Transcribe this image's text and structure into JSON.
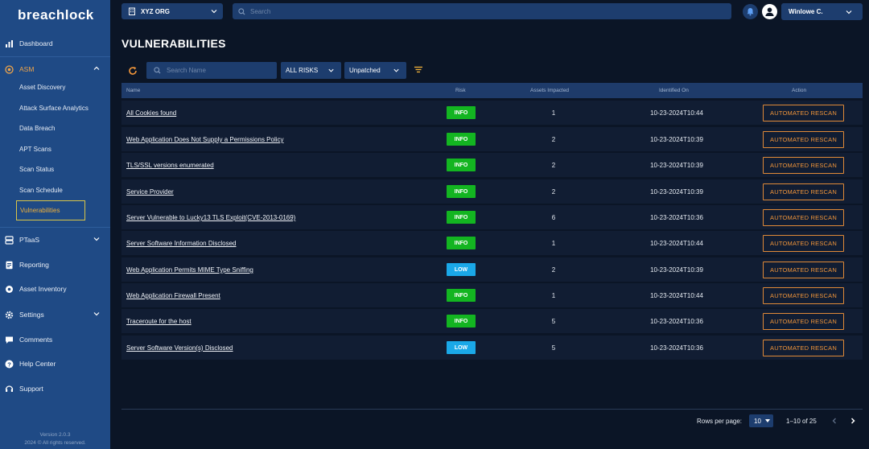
{
  "app": {
    "logo": "breachlock",
    "org": "XYZ ORG",
    "search_placeholder": "Search",
    "user": "Winlowe C."
  },
  "sidebar": {
    "dashboard": "Dashboard",
    "asm": "ASM",
    "asm_items": [
      "Asset Discovery",
      "Attack Surface Analytics",
      "Data Breach",
      "APT Scans",
      "Scan Status",
      "Scan Schedule",
      "Vulnerabilities"
    ],
    "ptaas": "PTaaS",
    "reporting": "Reporting",
    "asset_inventory": "Asset Inventory",
    "settings": "Settings",
    "comments": "Comments",
    "help_center": "Help Center",
    "support": "Support",
    "version": "Version 2.0.3",
    "copyright": "2024 © All rights reserved."
  },
  "page": {
    "title": "VULNERABILITIES"
  },
  "filters": {
    "search_placeholder": "Search Name",
    "risk": "ALL RISKS",
    "status": "Unpatched"
  },
  "table": {
    "headers": {
      "name": "Name",
      "risk": "Risk",
      "assets": "Assets Impacted",
      "identified": "Identified On",
      "action": "Action"
    },
    "action_label": "AUTOMATED RESCAN",
    "rows": [
      {
        "name": "All Cookies found",
        "risk": "INFO",
        "assets": "1",
        "identified": "10-23-2024T10:44"
      },
      {
        "name": "Web Application Does Not Supply a Permissions Policy",
        "risk": "INFO",
        "assets": "2",
        "identified": "10-23-2024T10:39"
      },
      {
        "name": "TLS/SSL versions enumerated",
        "risk": "INFO",
        "assets": "2",
        "identified": "10-23-2024T10:39"
      },
      {
        "name": "Service Provider",
        "risk": "INFO",
        "assets": "2",
        "identified": "10-23-2024T10:39"
      },
      {
        "name": "Server Vulnerable to Lucky13 TLS Exploit(CVE-2013-0169)",
        "risk": "INFO",
        "assets": "6",
        "identified": "10-23-2024T10:36"
      },
      {
        "name": "Server Software Information Disclosed",
        "risk": "INFO",
        "assets": "1",
        "identified": "10-23-2024T10:44"
      },
      {
        "name": "Web Application Permits MIME Type Sniffing",
        "risk": "LOW",
        "assets": "2",
        "identified": "10-23-2024T10:39"
      },
      {
        "name": "Web Application Firewall Present",
        "risk": "INFO",
        "assets": "1",
        "identified": "10-23-2024T10:44"
      },
      {
        "name": "Traceroute for the host",
        "risk": "INFO",
        "assets": "5",
        "identified": "10-23-2024T10:36"
      },
      {
        "name": "Server Software Version(s) Disclosed",
        "risk": "LOW",
        "assets": "5",
        "identified": "10-23-2024T10:36"
      }
    ]
  },
  "pagination": {
    "rows_per_page_label": "Rows per page:",
    "rows_per_page": "10",
    "range": "1–10 of 25"
  },
  "colors": {
    "info": "#13b521",
    "low": "#1aa8e8",
    "accent": "#f0953a",
    "sidebar": "#1f4a85"
  }
}
